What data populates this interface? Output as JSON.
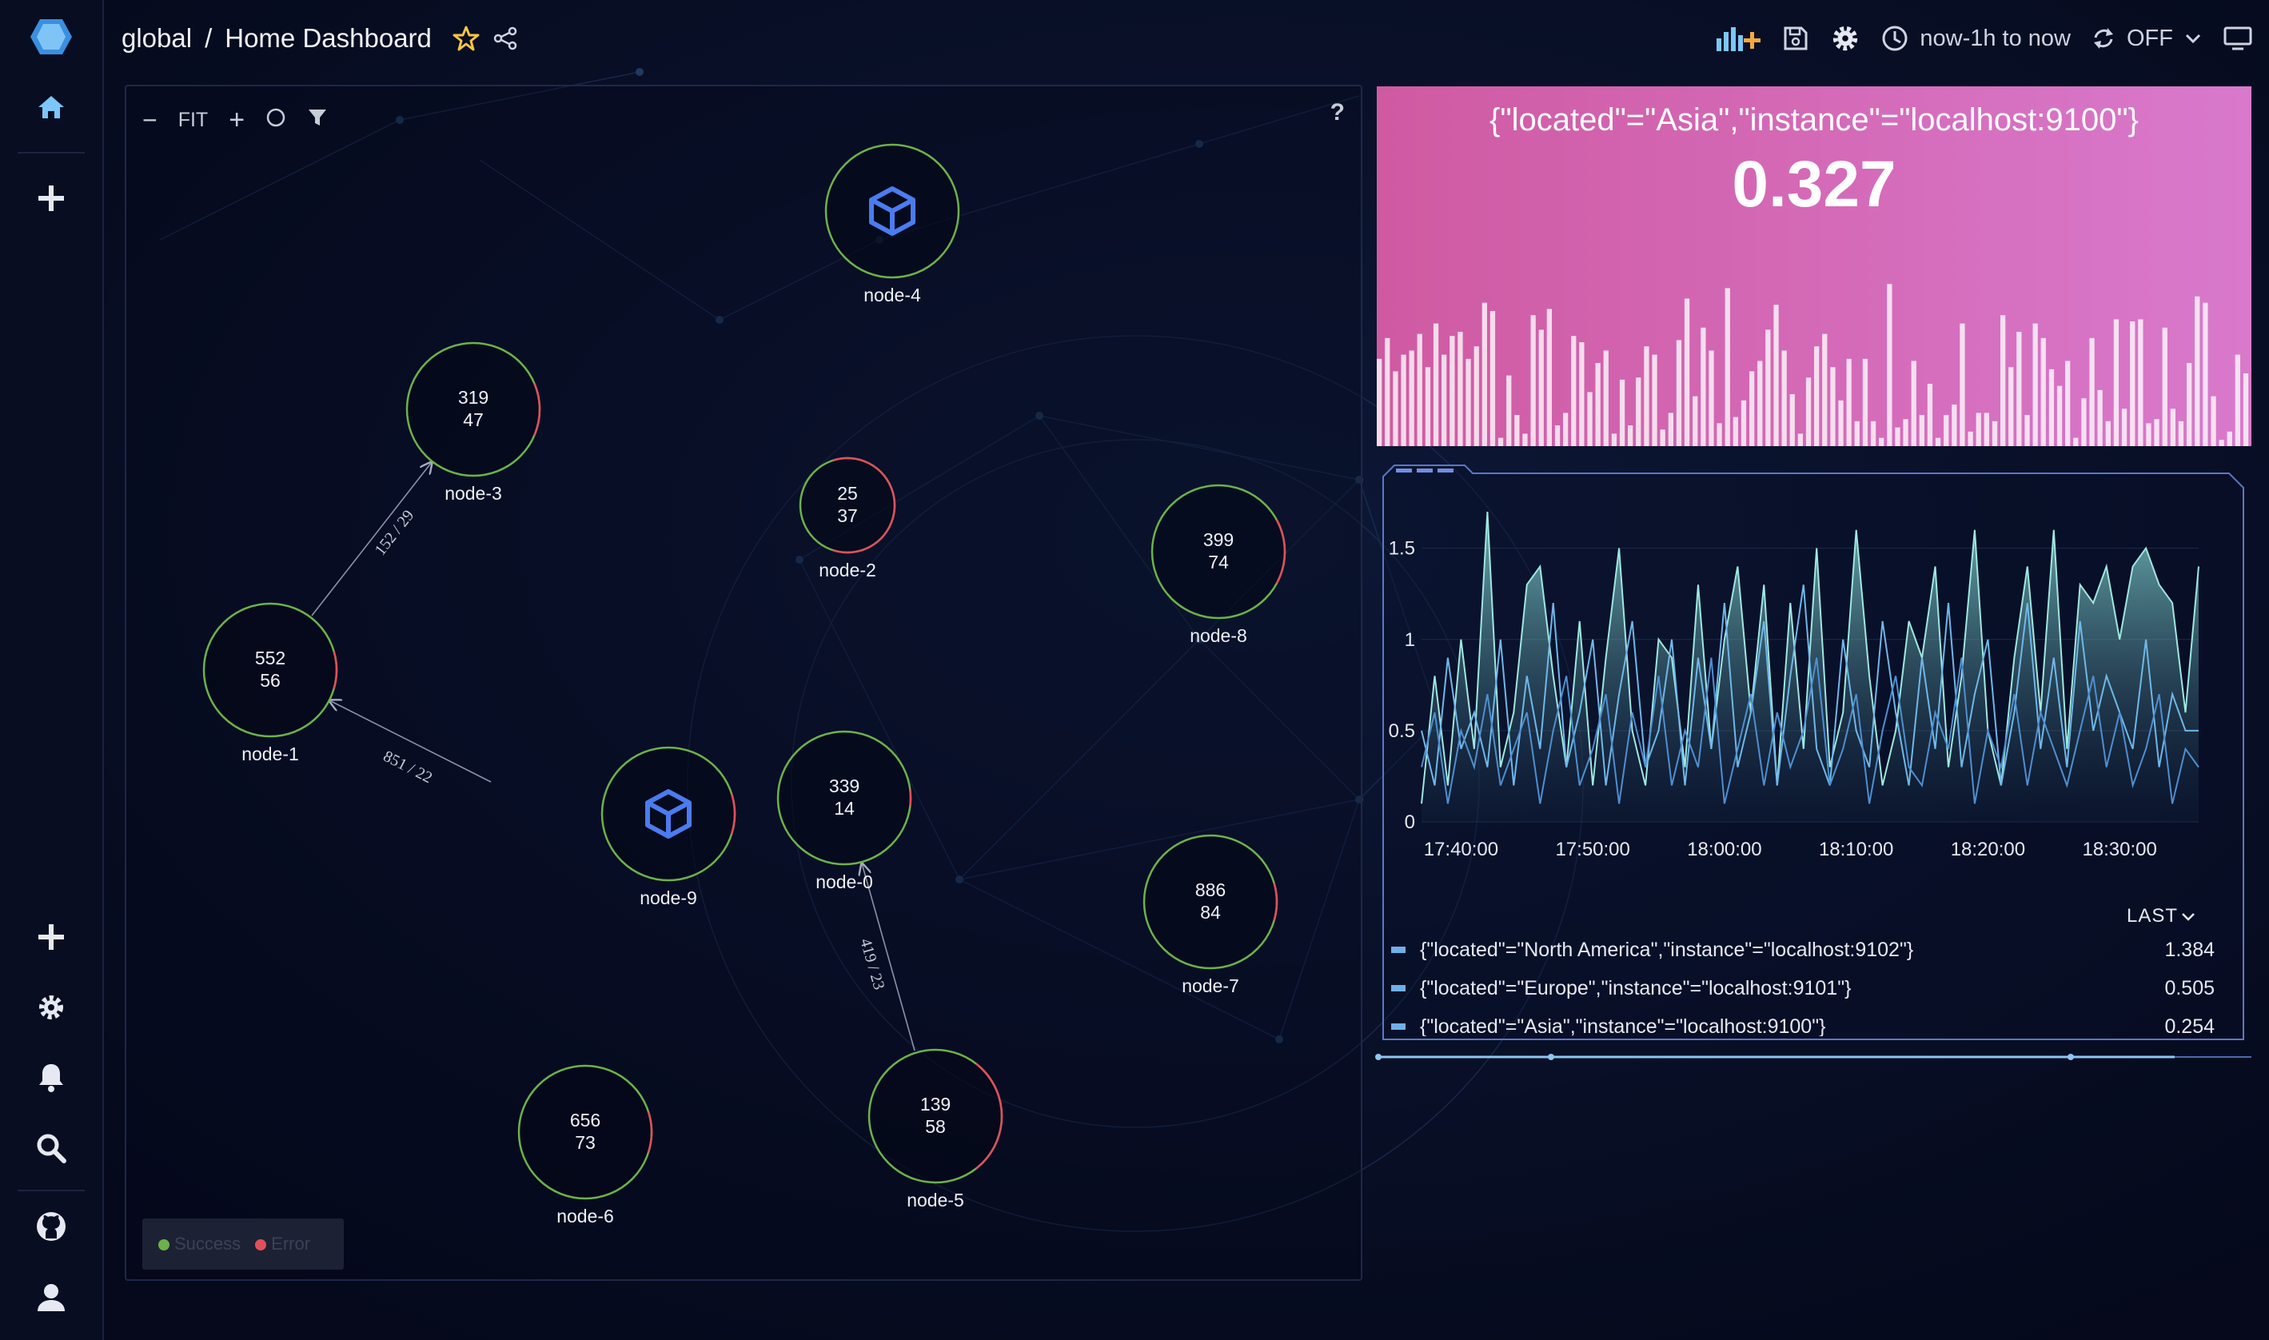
{
  "app": {
    "title": "Home Dashboard"
  },
  "breadcrumb": {
    "folder": "global",
    "separator": "/",
    "dashboard": "Home Dashboard"
  },
  "toolbar": {
    "time_range": "now-1h to now",
    "refresh": "OFF",
    "icons": [
      "add-panel-icon",
      "save-icon",
      "gear-icon",
      "clock-icon",
      "refresh-icon",
      "chevron-down-icon",
      "tv-mode-icon"
    ]
  },
  "sidebar": {
    "top_items": [
      "logo-icon",
      "home-icon",
      "plus-icon"
    ],
    "bottom_items": [
      "plus-icon",
      "gear-icon",
      "bell-icon",
      "search-icon",
      "github-icon",
      "user-icon"
    ]
  },
  "topology": {
    "toolbar": {
      "zoom_out": "−",
      "fit": "FIT",
      "zoom_in": "+",
      "help": "?"
    },
    "nodes": [
      {
        "id": "node-4",
        "label": "node-4",
        "kind": "service",
        "error_fraction": 0.0
      },
      {
        "id": "node-3",
        "label": "node-3",
        "line1": "319",
        "line2": "47",
        "error_fraction": 0.13
      },
      {
        "id": "node-2",
        "label": "node-2",
        "line1": "25",
        "line2": "37",
        "error_fraction": 0.6
      },
      {
        "id": "node-8",
        "label": "node-8",
        "line1": "399",
        "line2": "74",
        "error_fraction": 0.16
      },
      {
        "id": "node-1",
        "label": "node-1",
        "line1": "552",
        "line2": "56",
        "error_fraction": 0.09
      },
      {
        "id": "node-9",
        "label": "node-9",
        "kind": "service",
        "error_fraction": 0.1
      },
      {
        "id": "node-0",
        "label": "node-0",
        "line1": "339",
        "line2": "14",
        "error_fraction": 0.04
      },
      {
        "id": "node-7",
        "label": "node-7",
        "line1": "886",
        "line2": "84",
        "error_fraction": 0.09
      },
      {
        "id": "node-6",
        "label": "node-6",
        "line1": "656",
        "line2": "73",
        "error_fraction": 0.1
      },
      {
        "id": "node-5",
        "label": "node-5",
        "line1": "139",
        "line2": "58",
        "error_fraction": 0.29
      }
    ],
    "edges": [
      {
        "from": "node-1",
        "to": "node-3",
        "label": "152 / 29"
      },
      {
        "from": "node-9",
        "to": "node-1",
        "label": "851 / 22"
      },
      {
        "from": "node-5",
        "to": "node-0",
        "label": "419 / 23"
      }
    ],
    "legend": {
      "success": "Success",
      "error": "Error",
      "success_color": "#6cb24a",
      "error_color": "#e0505a"
    }
  },
  "stat": {
    "title": "{\"located\"=\"Asia\",\"instance\"=\"localhost:9100\"}",
    "value": "0.327",
    "background": "#d46cb8"
  },
  "timeseries": {
    "legend_header": "LAST",
    "legend": [
      {
        "name": "{\"located\"=\"North America\",\"instance\"=\"localhost:9102\"}",
        "last": "1.384"
      },
      {
        "name": "{\"located\"=\"Europe\",\"instance\"=\"localhost:9101\"}",
        "last": "0.505"
      },
      {
        "name": "{\"located\"=\"Asia\",\"instance\"=\"localhost:9100\"}",
        "last": "0.254"
      }
    ]
  },
  "chart_data": [
    {
      "type": "bar",
      "title": "",
      "values": [
        0.42,
        0.52,
        0.36,
        0.44,
        0.46,
        0.54,
        0.38,
        0.59,
        0.44,
        0.53,
        0.55,
        0.42,
        0.48,
        0.69,
        0.65,
        0.04,
        0.34,
        0.15,
        0.06,
        0.63,
        0.56,
        0.66,
        0.1,
        0.16,
        0.53,
        0.5,
        0.26,
        0.4,
        0.46,
        0.06,
        0.32,
        0.1,
        0.33,
        0.48,
        0.44,
        0.08,
        0.16,
        0.51,
        0.71,
        0.24,
        0.57,
        0.46,
        0.11,
        0.76,
        0.14,
        0.22,
        0.36,
        0.41,
        0.56,
        0.68,
        0.46,
        0.25,
        0.06,
        0.33,
        0.48,
        0.54,
        0.38,
        0.22,
        0.42,
        0.12,
        0.42,
        0.12,
        0.04,
        0.78,
        0.09,
        0.13,
        0.41,
        0.15,
        0.3,
        0.04,
        0.15,
        0.2,
        0.59,
        0.07,
        0.16,
        0.16,
        0.12,
        0.63,
        0.38,
        0.55,
        0.15,
        0.59,
        0.52,
        0.37,
        0.29,
        0.41,
        0.04,
        0.23,
        0.52,
        0.27,
        0.12,
        0.61,
        0.18,
        0.6,
        0.61,
        0.11,
        0.13,
        0.57,
        0.18,
        0.12,
        0.4,
        0.72,
        0.69,
        0.24,
        0.03,
        0.07,
        0.44,
        0.35
      ],
      "ylim": [
        0,
        1
      ]
    },
    {
      "type": "area",
      "title": "",
      "x": [
        "17:37",
        "17:38",
        "17:39",
        "17:40",
        "17:41",
        "17:42",
        "17:43",
        "17:44",
        "17:45",
        "17:46",
        "17:47",
        "17:48",
        "17:49",
        "17:50",
        "17:51",
        "17:52",
        "17:53",
        "17:54",
        "17:55",
        "17:56",
        "17:57",
        "17:58",
        "17:59",
        "18:00",
        "18:01",
        "18:02",
        "18:03",
        "18:04",
        "18:05",
        "18:06",
        "18:07",
        "18:08",
        "18:09",
        "18:10",
        "18:11",
        "18:12",
        "18:13",
        "18:14",
        "18:15",
        "18:16",
        "18:17",
        "18:18",
        "18:19",
        "18:20",
        "18:21",
        "18:22",
        "18:23",
        "18:24",
        "18:25",
        "18:26",
        "18:27",
        "18:28",
        "18:29",
        "18:30",
        "18:31",
        "18:32",
        "18:33",
        "18:34",
        "18:35",
        "18:36"
      ],
      "xticks": [
        "17:40:00",
        "17:50:00",
        "18:00:00",
        "18:10:00",
        "18:20:00",
        "18:30:00"
      ],
      "yticks": [
        "0",
        "0.5",
        "1",
        "1.5"
      ],
      "ylim": [
        0,
        1.7
      ],
      "series": [
        {
          "values": [
            0.1,
            0.8,
            0.2,
            1.0,
            0.4,
            1.7,
            0.3,
            0.6,
            1.3,
            1.4,
            0.8,
            0.3,
            1.1,
            0.2,
            0.9,
            1.5,
            0.5,
            0.2,
            1.0,
            0.9,
            0.3,
            1.3,
            0.4,
            1.0,
            1.4,
            0.6,
            1.3,
            0.2,
            1.2,
            0.4,
            1.5,
            0.3,
            0.6,
            1.6,
            0.8,
            0.2,
            0.5,
            1.1,
            0.9,
            1.4,
            0.3,
            0.8,
            1.6,
            0.5,
            0.2,
            0.9,
            1.4,
            0.6,
            1.6,
            0.4,
            1.3,
            1.2,
            1.4,
            1.0,
            1.4,
            1.5,
            1.3,
            1.2,
            0.6,
            1.4
          ]
        },
        {
          "values": [
            0.5,
            0.2,
            0.9,
            0.4,
            0.6,
            0.3,
            1.0,
            0.2,
            0.8,
            0.4,
            1.2,
            0.3,
            0.6,
            1.0,
            0.2,
            0.7,
            1.1,
            0.3,
            0.5,
            1.0,
            0.2,
            0.9,
            0.4,
            1.2,
            0.3,
            0.6,
            1.1,
            0.2,
            0.8,
            1.3,
            0.4,
            0.2,
            1.0,
            0.5,
            0.3,
            1.1,
            0.6,
            0.2,
            0.9,
            0.4,
            1.2,
            0.3,
            0.7,
            1.0,
            0.2,
            0.6,
            1.2,
            0.4,
            0.9,
            0.3,
            1.1,
            0.5,
            0.8,
            0.6,
            0.4,
            1.0,
            0.3,
            0.7,
            0.5,
            0.5
          ]
        },
        {
          "values": [
            0.3,
            0.6,
            0.1,
            0.5,
            0.3,
            0.7,
            0.2,
            0.4,
            0.6,
            0.1,
            0.5,
            0.8,
            0.2,
            0.4,
            0.7,
            0.1,
            0.6,
            0.3,
            0.8,
            0.2,
            0.5,
            0.3,
            0.9,
            0.1,
            0.4,
            0.7,
            0.2,
            0.6,
            0.3,
            0.5,
            0.9,
            0.2,
            0.4,
            0.7,
            0.1,
            0.5,
            0.8,
            0.3,
            0.2,
            0.6,
            0.4,
            0.9,
            0.1,
            0.5,
            0.3,
            0.7,
            0.2,
            0.6,
            0.4,
            0.2,
            0.5,
            0.8,
            0.3,
            0.6,
            0.2,
            0.4,
            0.7,
            0.1,
            0.4,
            0.3
          ]
        }
      ]
    }
  ]
}
